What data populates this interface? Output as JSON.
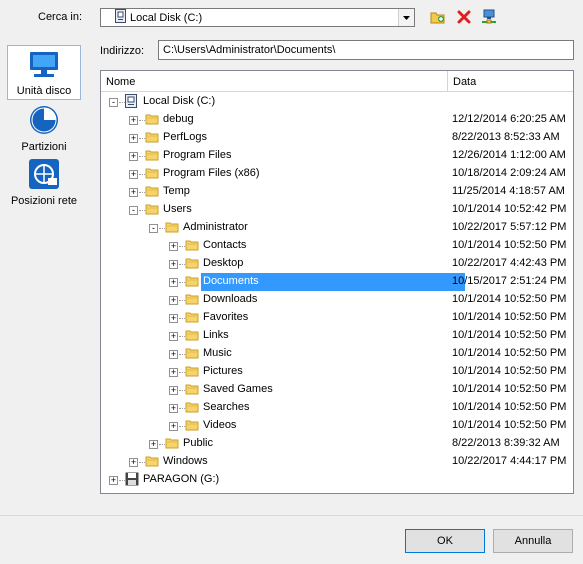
{
  "lookin": {
    "label": "Cerca in:",
    "value": "Local Disk (C:)"
  },
  "toolbar": {
    "new_folder": "new-folder-icon",
    "delete": "delete-icon",
    "network": "network-icon"
  },
  "sidebar": {
    "items": [
      {
        "label": "Unità disco",
        "icon": "monitor-icon"
      },
      {
        "label": "Partizioni",
        "icon": "pie-icon"
      },
      {
        "label": "Posizioni rete",
        "icon": "network-globe-icon"
      }
    ]
  },
  "address": {
    "label": "Indirizzo:",
    "value": "C:\\Users\\Administrator\\Documents\\"
  },
  "tree": {
    "headers": {
      "name": "Nome",
      "date": "Data"
    },
    "rows": [
      {
        "name": "Local Disk (C:)",
        "date": "",
        "level": 0,
        "type": "drive",
        "expander": "-"
      },
      {
        "name": "debug",
        "date": "12/12/2014 6:20:25 AM",
        "level": 1,
        "type": "folder",
        "expander": "+"
      },
      {
        "name": "PerfLogs",
        "date": "8/22/2013 8:52:33 AM",
        "level": 1,
        "type": "folder",
        "expander": "+"
      },
      {
        "name": "Program Files",
        "date": "12/26/2014 1:12:00 AM",
        "level": 1,
        "type": "folder",
        "expander": "+"
      },
      {
        "name": "Program Files (x86)",
        "date": "10/18/2014 2:09:24 AM",
        "level": 1,
        "type": "folder",
        "expander": "+"
      },
      {
        "name": "Temp",
        "date": "11/25/2014 4:18:57 AM",
        "level": 1,
        "type": "folder",
        "expander": "+"
      },
      {
        "name": "Users",
        "date": "10/1/2014 10:52:42 PM",
        "level": 1,
        "type": "folder",
        "expander": "-"
      },
      {
        "name": "Administrator",
        "date": "10/22/2017 5:57:12 PM",
        "level": 2,
        "type": "folder",
        "expander": "-"
      },
      {
        "name": "Contacts",
        "date": "10/1/2014 10:52:50 PM",
        "level": 3,
        "type": "folder",
        "expander": "+"
      },
      {
        "name": "Desktop",
        "date": "10/22/2017 4:42:43 PM",
        "level": 3,
        "type": "folder",
        "expander": "+"
      },
      {
        "name": "Documents",
        "date": "10/15/2017 2:51:24 PM",
        "level": 3,
        "type": "folder",
        "expander": "+",
        "selected": true
      },
      {
        "name": "Downloads",
        "date": "10/1/2014 10:52:50 PM",
        "level": 3,
        "type": "folder",
        "expander": "+"
      },
      {
        "name": "Favorites",
        "date": "10/1/2014 10:52:50 PM",
        "level": 3,
        "type": "folder",
        "expander": "+"
      },
      {
        "name": "Links",
        "date": "10/1/2014 10:52:50 PM",
        "level": 3,
        "type": "folder",
        "expander": "+"
      },
      {
        "name": "Music",
        "date": "10/1/2014 10:52:50 PM",
        "level": 3,
        "type": "folder",
        "expander": "+"
      },
      {
        "name": "Pictures",
        "date": "10/1/2014 10:52:50 PM",
        "level": 3,
        "type": "folder",
        "expander": "+"
      },
      {
        "name": "Saved Games",
        "date": "10/1/2014 10:52:50 PM",
        "level": 3,
        "type": "folder",
        "expander": "+"
      },
      {
        "name": "Searches",
        "date": "10/1/2014 10:52:50 PM",
        "level": 3,
        "type": "folder",
        "expander": "+"
      },
      {
        "name": "Videos",
        "date": "10/1/2014 10:52:50 PM",
        "level": 3,
        "type": "folder",
        "expander": "+"
      },
      {
        "name": "Public",
        "date": "8/22/2013 8:39:32 AM",
        "level": 2,
        "type": "folder",
        "expander": "+"
      },
      {
        "name": "Windows",
        "date": "10/22/2017 4:44:17 PM",
        "level": 1,
        "type": "folder",
        "expander": "+"
      },
      {
        "name": "PARAGON (G:)",
        "date": "",
        "level": 0,
        "type": "floppy",
        "expander": "+"
      }
    ]
  },
  "buttons": {
    "ok": "OK",
    "cancel": "Annulla"
  }
}
